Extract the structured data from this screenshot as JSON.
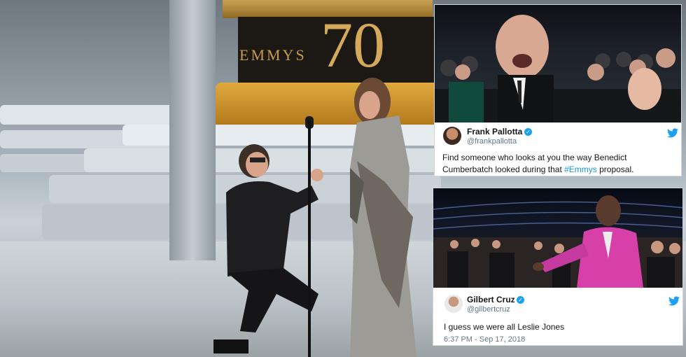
{
  "scene": {
    "statue_word": "EMMYS",
    "statue_number": "70"
  },
  "tweets": [
    {
      "name": "Frank Pallotta",
      "handle": "@frankpallotta",
      "text_before": "Find someone who looks at you the way Benedict Cumberbatch looked during that ",
      "hashtag": "#Emmys",
      "text_after": " proposal.",
      "verified": true,
      "icon": "twitter-bird-icon",
      "accent": "#1da1f2"
    },
    {
      "name": "Gilbert Cruz",
      "handle": "@gilbertcruz",
      "text": "I guess we were all Leslie Jones",
      "timestamp": "6:37 PM - Sep 17, 2018",
      "verified": true,
      "icon": "twitter-bird-icon",
      "accent": "#1da1f2"
    }
  ]
}
